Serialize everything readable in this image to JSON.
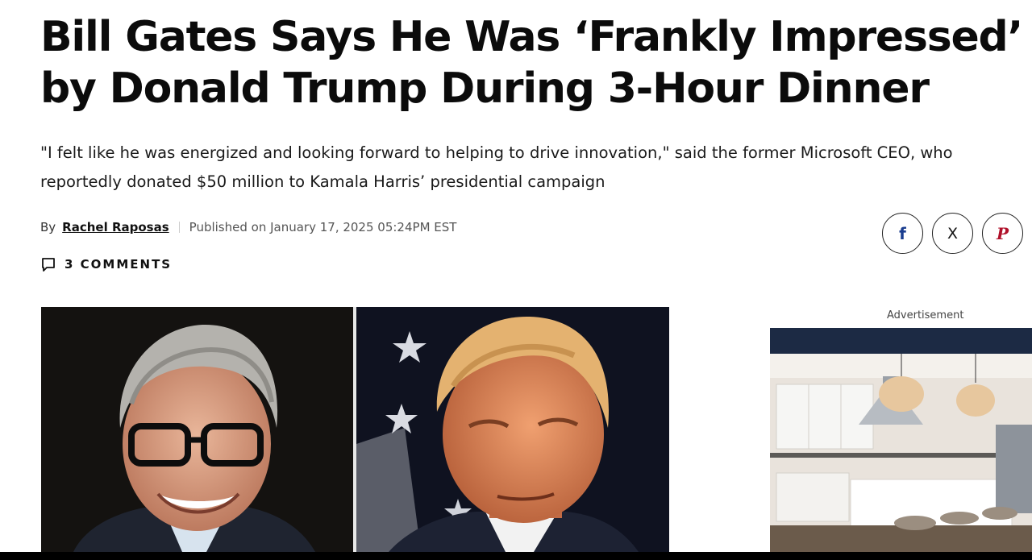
{
  "article": {
    "headline_line1": "Bill Gates Says He Was ‘Frankly Impressed’",
    "headline_line2": "by Donald Trump During 3-Hour Dinner",
    "dek_line1": "\"I felt like he was energized and looking forward to helping to drive innovation,\" said the former Microsoft CEO, who",
    "dek_line2": "reportedly donated $50 million to Kamala Harris’ presidential campaign",
    "by_prefix": "By",
    "author": "Rachel Raposas",
    "published": "Published on January 17, 2025 05:24PM EST",
    "comments_label": "3 COMMENTS"
  },
  "share": {
    "facebook": "f",
    "x": "X",
    "pinterest": "P"
  },
  "ad": {
    "label": "Advertisement"
  },
  "colors": {
    "text": "#0b0b0b",
    "share_border": "#222222",
    "ad_header": "#1c2a44"
  }
}
